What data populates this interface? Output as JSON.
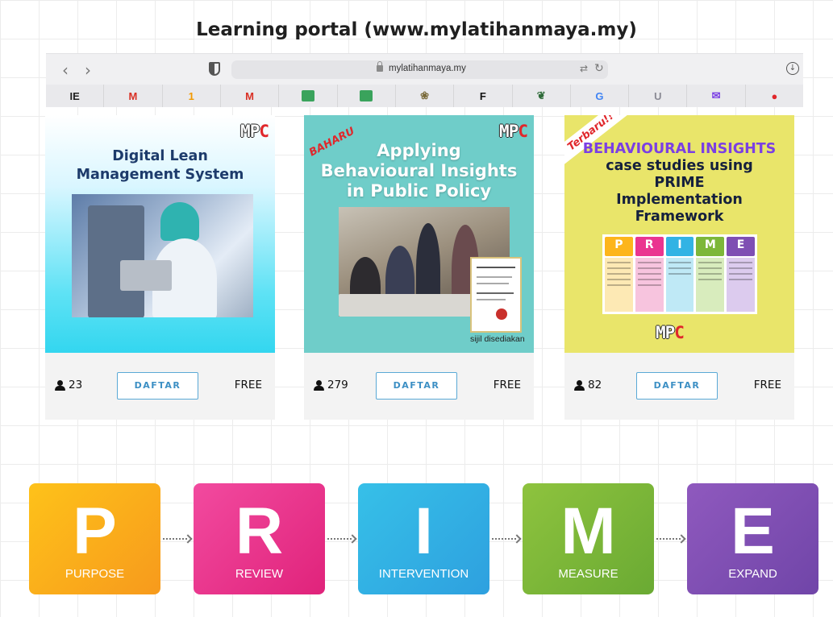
{
  "heading": "Learning portal (www.mylatihanmaya.my)",
  "browser": {
    "url": "mylatihanmaya.my",
    "bookmarks": [
      {
        "icon": "tech-e-icon",
        "glyph": "IE",
        "color": "#222222"
      },
      {
        "icon": "gmail-icon",
        "glyph": "M",
        "color": "#d93025"
      },
      {
        "icon": "one-icon",
        "glyph": "1",
        "color": "#f29900"
      },
      {
        "icon": "gmail-icon",
        "glyph": "M",
        "color": "#d93025"
      },
      {
        "icon": "green-site-icon",
        "glyph": "",
        "color": "#3aa35c"
      },
      {
        "icon": "green-site-icon",
        "glyph": "",
        "color": "#3aa35c"
      },
      {
        "icon": "emblem-icon",
        "glyph": "❀",
        "color": "#7a6a3a"
      },
      {
        "icon": "f-icon",
        "glyph": "F",
        "color": "#111111"
      },
      {
        "icon": "leaf-icon",
        "glyph": "❦",
        "color": "#2f6b3a"
      },
      {
        "icon": "google-icon",
        "glyph": "G",
        "color": "#4285f4"
      },
      {
        "icon": "u-icon",
        "glyph": "U",
        "color": "#8b8b95"
      },
      {
        "icon": "mail-icon",
        "glyph": "✉",
        "color": "#7b3fe4"
      },
      {
        "icon": "opera-icon",
        "glyph": "●",
        "color": "#e0272b"
      }
    ]
  },
  "logo": {
    "mp": "MP",
    "c": "C"
  },
  "courses": [
    {
      "title_lines": [
        "Digital Lean",
        "Management System"
      ],
      "enrolled": "23",
      "button": "DAFTAR",
      "price": "FREE"
    },
    {
      "ribbon": "BAHARU",
      "title_lines": [
        "Applying",
        "Behavioural Insights",
        "in Public Policy"
      ],
      "certificate_note": "sijil disediakan",
      "enrolled": "279",
      "button": "DAFTAR",
      "price": "FREE"
    },
    {
      "ribbon": "Terbaru!!",
      "title_highlight": "BEHAVIOURAL INSIGHTS",
      "title_lines": [
        "case studies using",
        "PRIME",
        "Implementation",
        "Framework"
      ],
      "enrolled": "82",
      "button": "DAFTAR",
      "price": "FREE"
    }
  ],
  "prime": [
    {
      "letter": "P",
      "word": "PURPOSE",
      "color": "#fdb51b"
    },
    {
      "letter": "R",
      "word": "REVIEW",
      "color": "#ea3590"
    },
    {
      "letter": "I",
      "word": "INTERVENTION",
      "color": "#32b3e4"
    },
    {
      "letter": "M",
      "word": "MEASURE",
      "color": "#7db739"
    },
    {
      "letter": "E",
      "word": "EXPAND",
      "color": "#7f4fb3"
    }
  ]
}
